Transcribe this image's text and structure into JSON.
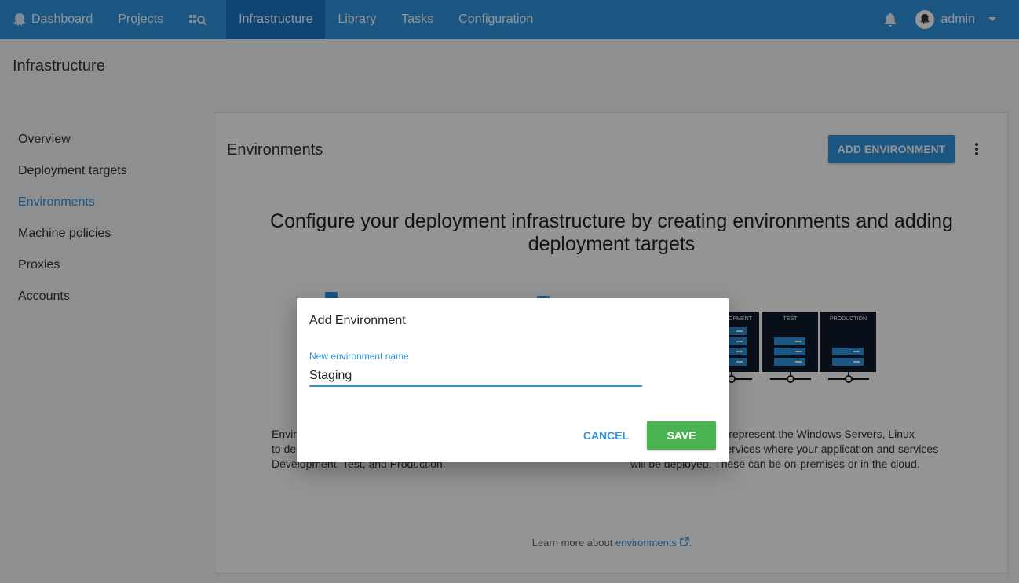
{
  "nav": {
    "items": [
      {
        "label": "Dashboard",
        "icon": "octopus-icon"
      },
      {
        "label": "Projects"
      },
      {
        "label": "",
        "icon": "task-board-search-icon"
      },
      {
        "label": "Infrastructure",
        "active": true
      },
      {
        "label": "Library"
      },
      {
        "label": "Tasks"
      },
      {
        "label": "Configuration"
      }
    ],
    "user": "admin",
    "bell_icon": "bell-icon",
    "caret_icon": "caret-down-icon"
  },
  "page": {
    "title": "Infrastructure"
  },
  "sidebar": {
    "items": [
      {
        "label": "Overview"
      },
      {
        "label": "Deployment targets"
      },
      {
        "label": "Environments",
        "active": true
      },
      {
        "label": "Machine policies"
      },
      {
        "label": "Proxies"
      },
      {
        "label": "Accounts"
      }
    ]
  },
  "main": {
    "title": "Environments",
    "add_button": "ADD ENVIRONMENT",
    "headline": "Configure your deployment infrastructure by creating environments and adding deployment targets",
    "illustration": {
      "env_labels": [
        "DEVELOPMENT",
        "TEST",
        "PRODUCTION"
      ]
    },
    "left_description": "Environments are groups of deployment targets you want to deploy to at the same time. Typical environments are Development, Test, and Production.",
    "right_description": "Deployment targets represent the Windows Servers, Linux servers and cloud services where your application and services will be deployed. These can be on-premises or in the cloud.",
    "learn_more_prefix": "Learn more about",
    "learn_more_link": "environments",
    "learn_more_suffix": "."
  },
  "dialog": {
    "title": "Add Environment",
    "field_label": "New environment name",
    "field_value": "Staging",
    "cancel": "CANCEL",
    "save": "SAVE"
  },
  "colors": {
    "brand": "#2f93e0",
    "nav_active": "#1a77ca",
    "save": "#48b350",
    "env_box": "#111a2b"
  }
}
